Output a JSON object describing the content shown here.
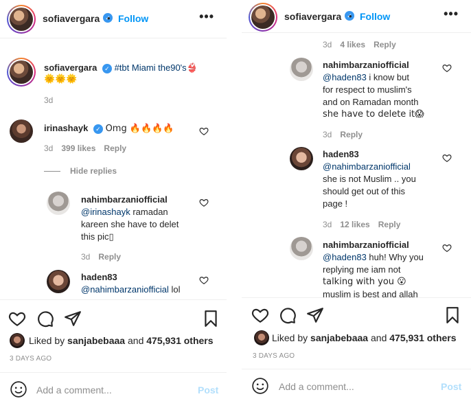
{
  "left": {
    "header": {
      "username": "sofiavergara",
      "follow": "Follow",
      "more": "•••"
    },
    "caption": {
      "username": "sofiavergara",
      "text": "#tbt Miami the90's",
      "emoji1": "👙",
      "emoji2": "🌞🌞🌞",
      "time": "3d"
    },
    "comments": [
      {
        "username": "irinashayk",
        "text": "Omg 🔥🔥🔥🔥",
        "time": "3d",
        "likes": "399 likes",
        "reply": "Reply"
      }
    ],
    "hide_replies": "Hide replies",
    "replies": [
      {
        "username": "nahimbarzaniofficial",
        "mention": "@irinashayk",
        "line1": " ramadan",
        "line2": "kareen she have to delet",
        "line3": "this pic▯",
        "time": "3d",
        "reply": "Reply"
      },
      {
        "username": "haden83",
        "mention": "@nahimbarzaniofficial",
        "text": " lol"
      }
    ],
    "liked_by": {
      "prefix": "Liked by ",
      "user": "sanjabebaaa",
      "mid": " and ",
      "count": "475,931 others"
    },
    "time_ago": "3 DAYS AGO",
    "add_comment": {
      "placeholder": "Add a comment...",
      "post": "Post"
    }
  },
  "right": {
    "header": {
      "username": "sofiavergara",
      "follow": "Follow",
      "more": "•••"
    },
    "top_meta": {
      "time": "3d",
      "likes": "4 likes",
      "reply": "Reply"
    },
    "replies": [
      {
        "username": "nahimbarzaniofficial",
        "mention": "@haden83",
        "line1": " i know but",
        "line2": "for respect to muslim's",
        "line3": "and on Ramadan month",
        "line4": "she have to delete it😱",
        "time": "3d",
        "reply": "Reply"
      },
      {
        "username": "haden83",
        "mention": "@nahimbarzaniofficial",
        "line2": "she is not Muslim .. you",
        "line3": "should get out of this",
        "line4": "page !",
        "time": "3d",
        "likes": "12 likes",
        "reply": "Reply"
      },
      {
        "username": "nahimbarzaniofficial",
        "mention": "@haden83",
        "line1": " huh! Why you",
        "line2": "replying me iam not",
        "line3": "talking with you 😮",
        "line4": "muslim is best and allah"
      }
    ],
    "liked_by": {
      "prefix": "Liked by ",
      "user": "sanjabebaaa",
      "mid": " and ",
      "count": "475,931 others"
    },
    "time_ago": "3 DAYS AGO",
    "add_comment": {
      "placeholder": "Add a comment...",
      "post": "Post"
    }
  }
}
